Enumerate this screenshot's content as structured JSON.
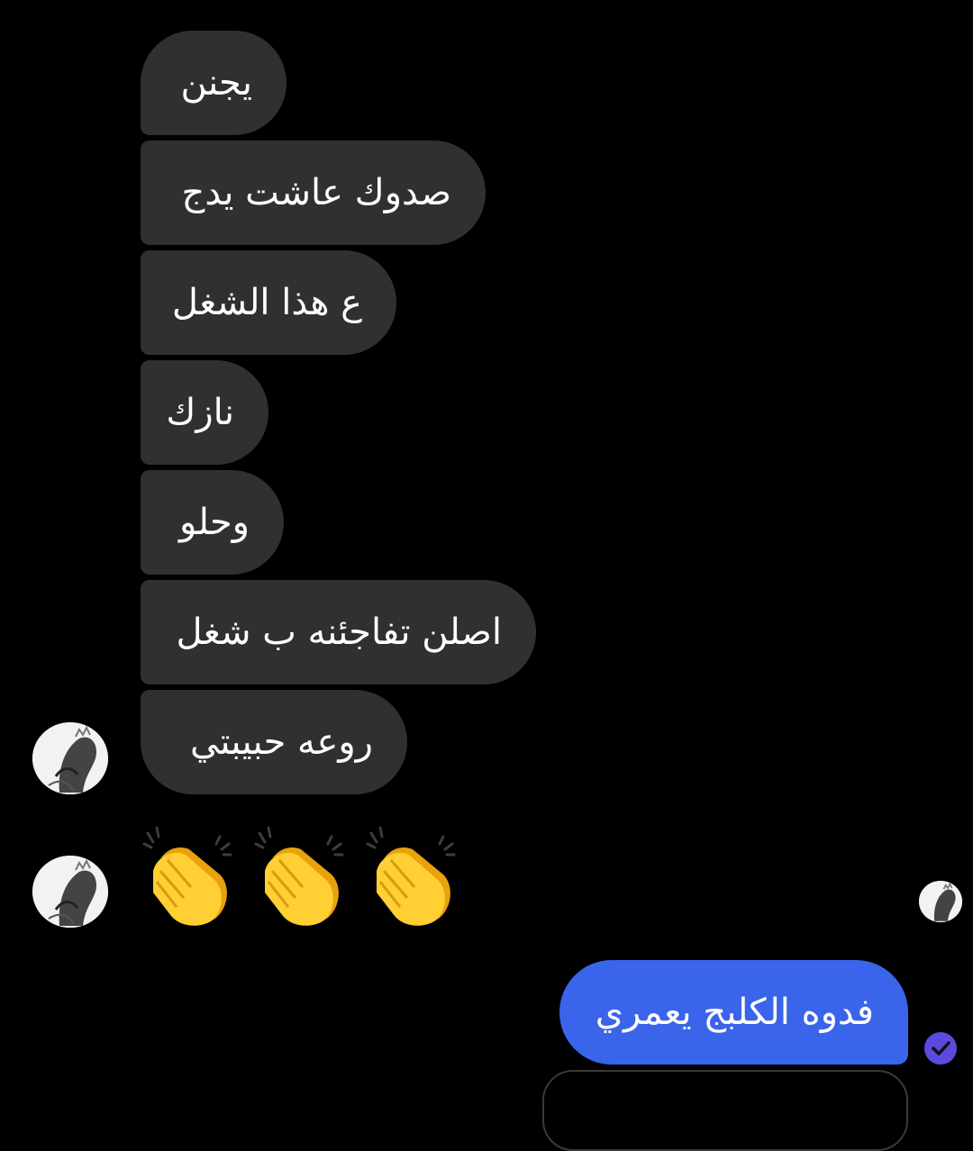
{
  "messages": {
    "incoming": [
      {
        "text": "يجنن"
      },
      {
        "text": "صدوك عاشت يدج"
      },
      {
        "text": "ع هذا الشغل"
      },
      {
        "text": "نازك"
      },
      {
        "text": "وحلو"
      },
      {
        "text": "اصلن تفاجئنه ب شغل"
      },
      {
        "text": "روعه حبيبتي"
      }
    ],
    "emoji_reaction": {
      "icon": "clapping-hands-icon",
      "count": 3
    },
    "outgoing": [
      {
        "text": "فدوه الكلبج يعمري",
        "status_icon": "read-check-icon"
      }
    ]
  },
  "colors": {
    "background": "#000000",
    "incoming_bubble": "#303030",
    "outgoing_bubble": "#3a64ea",
    "read_receipt": "#5b4bdd"
  }
}
